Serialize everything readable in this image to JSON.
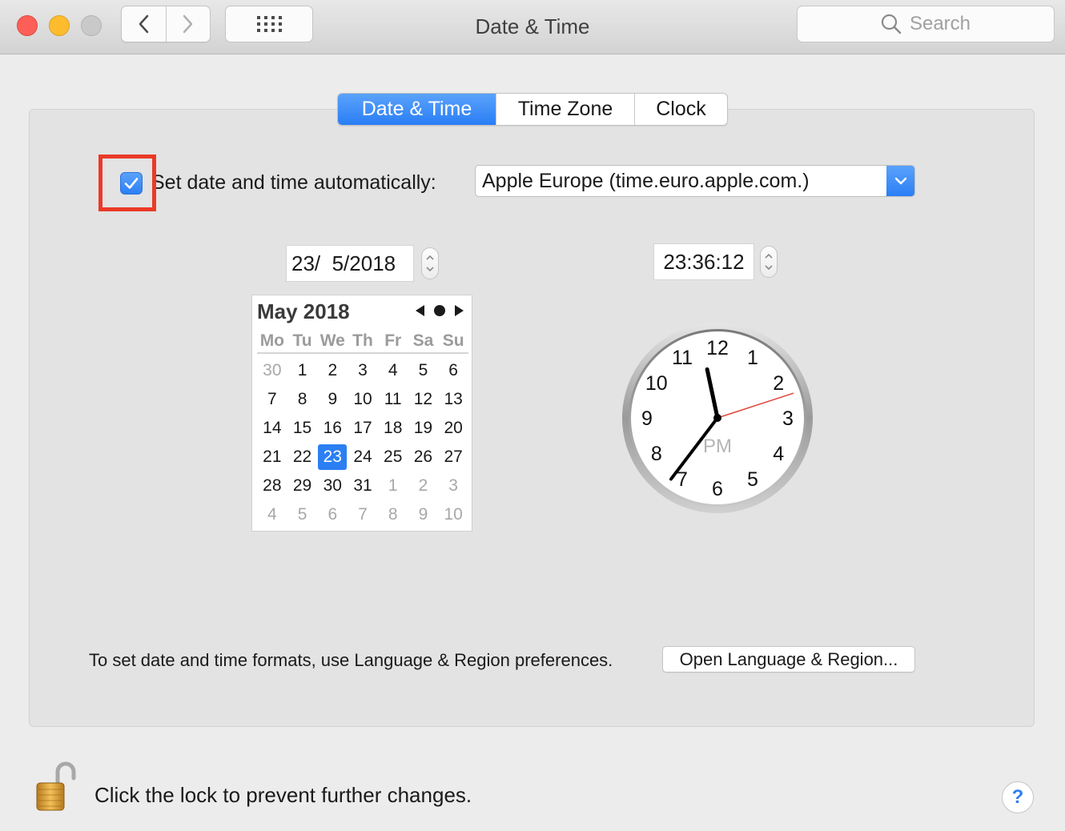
{
  "window": {
    "title": "Date & Time"
  },
  "search": {
    "placeholder": "Search"
  },
  "tabs": [
    {
      "label": "Date & Time",
      "active": true
    },
    {
      "label": "Time Zone",
      "active": false
    },
    {
      "label": "Clock",
      "active": false
    }
  ],
  "auto": {
    "checked": true,
    "label": "Set date and time automatically:",
    "server": "Apple Europe (time.euro.apple.com.)"
  },
  "date_field": {
    "value": "23/  5/2018"
  },
  "time_field": {
    "value": "23:36:12"
  },
  "calendar": {
    "title": "May 2018",
    "weekdays": [
      "Mo",
      "Tu",
      "We",
      "Th",
      "Fr",
      "Sa",
      "Su"
    ],
    "weeks": [
      [
        "30",
        "1",
        "2",
        "3",
        "4",
        "5",
        "6"
      ],
      [
        "7",
        "8",
        "9",
        "10",
        "11",
        "12",
        "13"
      ],
      [
        "14",
        "15",
        "16",
        "17",
        "18",
        "19",
        "20"
      ],
      [
        "21",
        "22",
        "23",
        "24",
        "25",
        "26",
        "27"
      ],
      [
        "28",
        "29",
        "30",
        "31",
        "1",
        "2",
        "3"
      ],
      [
        "4",
        "5",
        "6",
        "7",
        "8",
        "9",
        "10"
      ]
    ],
    "selected_day": "23",
    "first_month_day_index": 1,
    "last_month_day_index": 31
  },
  "clock": {
    "numbers": [
      "12",
      "1",
      "2",
      "3",
      "4",
      "5",
      "6",
      "7",
      "8",
      "9",
      "10",
      "11"
    ],
    "period": "PM",
    "hours": 23,
    "minutes": 36,
    "seconds": 12
  },
  "formats": {
    "text": "To set date and time formats, use Language & Region preferences.",
    "button": "Open Language & Region..."
  },
  "lock": {
    "text": "Click the lock to prevent further changes."
  },
  "help": {
    "label": "?"
  },
  "colors": {
    "accent": "#2b7ff5",
    "highlight": "#ea3a27",
    "second_hand": "#e0453a"
  },
  "icons": [
    "back-icon",
    "forward-icon",
    "grid-icon",
    "search-icon",
    "checkmark-icon",
    "chevron-down-icon",
    "lock-icon",
    "help-icon"
  ]
}
